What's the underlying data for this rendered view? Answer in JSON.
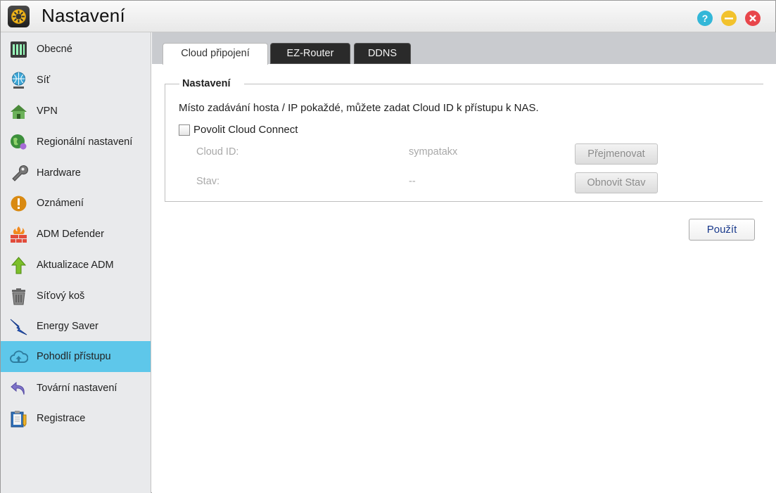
{
  "window": {
    "title": "Nastavení"
  },
  "titlebar_buttons": {
    "help_icon": "help-icon",
    "minimize_icon": "minimize-icon",
    "close_icon": "close-icon"
  },
  "sidebar": {
    "items": [
      {
        "label": "Obecné",
        "icon": "general-icon"
      },
      {
        "label": "Síť",
        "icon": "network-globe-icon"
      },
      {
        "label": "VPN",
        "icon": "vpn-house-icon"
      },
      {
        "label": "Regionální nastavení",
        "icon": "regional-globe-icon"
      },
      {
        "label": "Hardware",
        "icon": "hardware-wrench-icon"
      },
      {
        "label": "Oznámení",
        "icon": "notification-exclamation-icon"
      },
      {
        "label": "ADM Defender",
        "icon": "firewall-icon"
      },
      {
        "label": "Aktualizace ADM",
        "icon": "update-arrow-icon"
      },
      {
        "label": "Síťový koš",
        "icon": "recycle-bin-icon"
      },
      {
        "label": "Energy Saver",
        "icon": "energy-bolt-icon"
      },
      {
        "label": "Pohodlí přístupu",
        "icon": "cloud-upload-icon"
      },
      {
        "label": "Tovární nastavení",
        "icon": "undo-arrow-icon"
      },
      {
        "label": "Registrace",
        "icon": "clipboard-icon"
      }
    ],
    "active_index": 10
  },
  "tabs": [
    {
      "label": "Cloud připojení"
    },
    {
      "label": "EZ-Router"
    },
    {
      "label": "DDNS"
    }
  ],
  "settings": {
    "legend": "Nastavení",
    "description": "Místo zadávání hosta / IP pokaždé, můžete zadat Cloud ID k přístupu k NAS.",
    "enable_checkbox_label": "Povolit Cloud Connect",
    "enable_checked": false,
    "cloud_id_label": "Cloud ID:",
    "cloud_id_value": "sympatakx",
    "rename_button": "Přejmenovat",
    "status_label": "Stav:",
    "status_value": "--",
    "refresh_button": "Obnovit Stav"
  },
  "apply_button": "Použít",
  "colors": {
    "active_item": "#5ec7ea",
    "tab_dark": "#2a2a2a",
    "help": "#33b7d8",
    "minimize": "#f2c22d",
    "close": "#e8464b"
  }
}
